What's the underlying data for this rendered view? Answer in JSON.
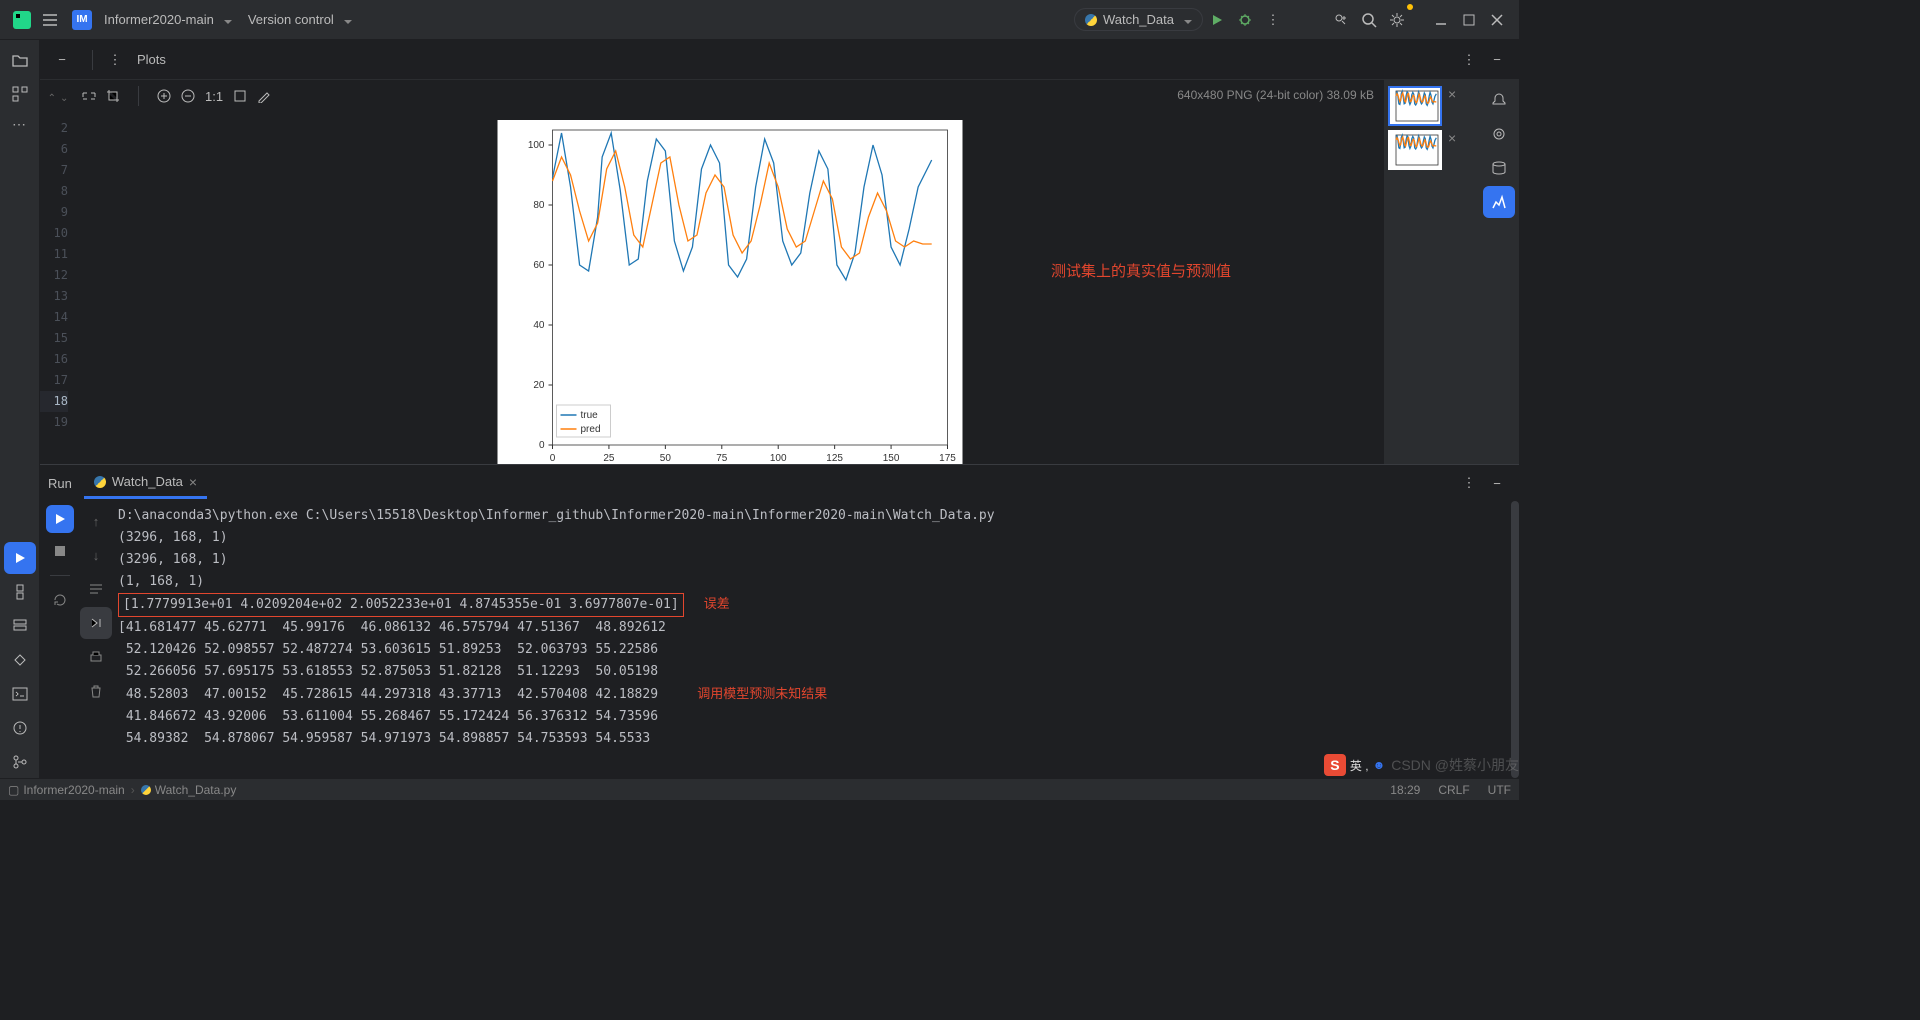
{
  "header": {
    "project_badge": "IM",
    "project_name": "Informer2020-main",
    "vcs_label": "Version control",
    "run_config": "Watch_Data"
  },
  "plots": {
    "title": "Plots",
    "zoom_label": "1:1",
    "info": "640x480 PNG (24-bit color) 38.09 kB",
    "annotation": "测试集上的真实值与预测值"
  },
  "gutter": {
    "lines": [
      "",
      "2",
      "",
      "",
      "",
      "6",
      "7",
      "8",
      "9",
      "10",
      "11",
      "12",
      "13",
      "14",
      "15",
      "16",
      "17",
      "18",
      "19"
    ],
    "current": "18"
  },
  "chart_data": {
    "type": "line",
    "xlim": [
      0,
      175
    ],
    "ylim": [
      0,
      105
    ],
    "xticks": [
      0,
      25,
      50,
      75,
      100,
      125,
      150,
      175
    ],
    "yticks": [
      0,
      20,
      40,
      60,
      80,
      100
    ],
    "legend": [
      "true",
      "pred"
    ],
    "legend_colors": [
      "#1f77b4",
      "#ff7f0e"
    ],
    "series": [
      {
        "name": "true",
        "color": "#1f77b4",
        "values": [
          [
            0,
            89
          ],
          [
            4,
            104
          ],
          [
            8,
            86
          ],
          [
            12,
            60
          ],
          [
            16,
            58
          ],
          [
            20,
            76
          ],
          [
            22,
            96
          ],
          [
            26,
            104
          ],
          [
            30,
            85
          ],
          [
            34,
            60
          ],
          [
            38,
            62
          ],
          [
            42,
            88
          ],
          [
            46,
            102
          ],
          [
            50,
            98
          ],
          [
            54,
            68
          ],
          [
            58,
            58
          ],
          [
            62,
            66
          ],
          [
            66,
            92
          ],
          [
            70,
            100
          ],
          [
            74,
            94
          ],
          [
            78,
            60
          ],
          [
            82,
            56
          ],
          [
            86,
            62
          ],
          [
            90,
            86
          ],
          [
            94,
            102
          ],
          [
            98,
            94
          ],
          [
            102,
            68
          ],
          [
            106,
            60
          ],
          [
            110,
            64
          ],
          [
            114,
            84
          ],
          [
            118,
            98
          ],
          [
            122,
            92
          ],
          [
            126,
            60
          ],
          [
            130,
            55
          ],
          [
            134,
            64
          ],
          [
            138,
            86
          ],
          [
            142,
            100
          ],
          [
            146,
            90
          ],
          [
            150,
            66
          ],
          [
            154,
            60
          ],
          [
            158,
            72
          ],
          [
            162,
            86
          ],
          [
            166,
            92
          ],
          [
            168,
            95
          ]
        ]
      },
      {
        "name": "pred",
        "color": "#ff7f0e",
        "values": [
          [
            0,
            88
          ],
          [
            4,
            96
          ],
          [
            8,
            90
          ],
          [
            12,
            78
          ],
          [
            16,
            68
          ],
          [
            20,
            74
          ],
          [
            24,
            92
          ],
          [
            28,
            98
          ],
          [
            32,
            86
          ],
          [
            36,
            70
          ],
          [
            40,
            66
          ],
          [
            44,
            80
          ],
          [
            48,
            94
          ],
          [
            52,
            96
          ],
          [
            56,
            80
          ],
          [
            60,
            68
          ],
          [
            64,
            70
          ],
          [
            68,
            84
          ],
          [
            72,
            90
          ],
          [
            76,
            86
          ],
          [
            80,
            70
          ],
          [
            84,
            64
          ],
          [
            88,
            68
          ],
          [
            92,
            80
          ],
          [
            96,
            94
          ],
          [
            100,
            86
          ],
          [
            104,
            72
          ],
          [
            108,
            66
          ],
          [
            112,
            68
          ],
          [
            116,
            78
          ],
          [
            120,
            88
          ],
          [
            124,
            82
          ],
          [
            128,
            66
          ],
          [
            132,
            62
          ],
          [
            136,
            64
          ],
          [
            140,
            76
          ],
          [
            144,
            84
          ],
          [
            148,
            78
          ],
          [
            152,
            68
          ],
          [
            156,
            66
          ],
          [
            160,
            68
          ],
          [
            164,
            67
          ],
          [
            168,
            67
          ]
        ]
      }
    ]
  },
  "run_panel": {
    "tab": "Run",
    "file": "Watch_Data",
    "lines": [
      "D:\\anaconda3\\python.exe C:\\Users\\15518\\Desktop\\Informer_github\\Informer2020-main\\Informer2020-main\\Watch_Data.py",
      "(3296, 168, 1)",
      "(3296, 168, 1)",
      "(1, 168, 1)"
    ],
    "error_line": "[1.7779913e+01 4.0209204e+02 2.0052233e+01 4.8745355e-01 3.6977807e-01]",
    "error_label": "误差",
    "pred_lines": [
      "[41.681477 45.62771  45.99176  46.086132 46.575794 47.51367  48.892612",
      " 52.120426 52.098557 52.487274 53.603615 51.89253  52.063793 55.22586",
      " 52.266056 57.695175 53.618553 52.875053 51.82128  51.12293  50.05198",
      " 48.52803  47.00152  45.728615 44.297318 43.37713  42.570408 42.18829",
      " 41.846672 43.92006  53.611004 55.268467 55.172424 56.376312 54.73596",
      " 54.89382  54.878067 54.959587 54.971973 54.898857 54.753593 54.5533"
    ],
    "pred_label": "调用模型预测未知结果"
  },
  "status": {
    "folder": "Informer2020-main",
    "file": "Watch_Data.py",
    "time": "18:29",
    "eol": "CRLF",
    "enc": "UTF"
  },
  "ime": {
    "badge": "S",
    "text": "英 ,",
    "csdn": "CSDN @姓蔡小朋友"
  }
}
